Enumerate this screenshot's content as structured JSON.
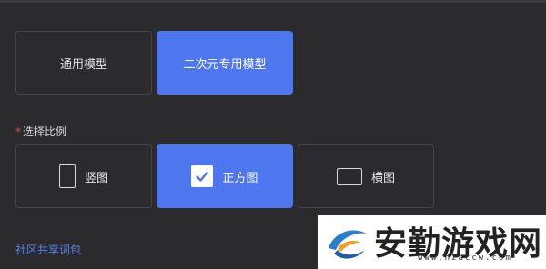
{
  "models": {
    "general_label": "通用模型",
    "anime_label": "二次元专用模型"
  },
  "ratio": {
    "required_mark": "*",
    "section_label": "选择比例",
    "portrait_label": "竖图",
    "square_label": "正方图",
    "landscape_label": "横图"
  },
  "links": {
    "community": "社区共享词包"
  },
  "watermark": {
    "title": "安勤游戏网",
    "url": "www.hzaccw.com"
  },
  "colors": {
    "background": "#2b2b2d",
    "accent": "#4e76ee",
    "link": "#5a85f0",
    "required": "#e34b4b"
  },
  "icons": {
    "portrait": "portrait-rect-icon",
    "square": "checkbox-checked-icon",
    "landscape": "landscape-rect-icon",
    "watermark_logo": "swoosh-logo"
  }
}
